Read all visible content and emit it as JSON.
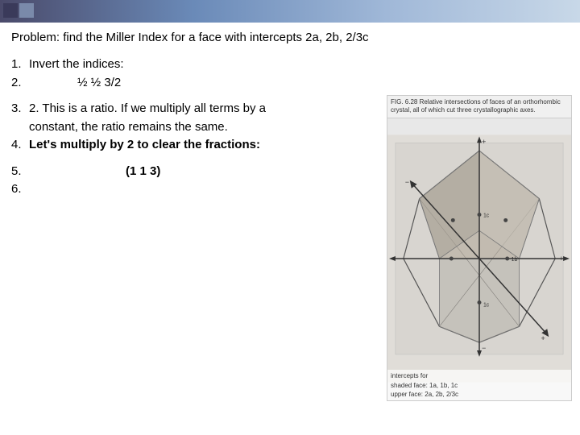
{
  "topbar": {
    "label": "top gradient bar"
  },
  "problem": {
    "title": "Problem: find the Miller Index for a face with intercepts 2a, 2b,  2/3c"
  },
  "steps": [
    {
      "num": "1.",
      "text": "Invert the indices:",
      "value": "",
      "bold": false
    },
    {
      "num": "2.",
      "text": "",
      "value": "½  ½  3/2",
      "bold": false
    },
    {
      "num": "3.",
      "text": "2. This is a ratio. If we multiply all terms by a",
      "continuation": "   constant, the ratio remains the same.",
      "value": "",
      "bold": false,
      "multiline": true
    },
    {
      "num": "4.",
      "text": "Let's multiply by 2 to clear the fractions:",
      "value": "",
      "bold": true
    },
    {
      "num": "5.",
      "text": "",
      "value": "(1 1 3)",
      "bold": true
    },
    {
      "num": "6.",
      "text": "",
      "value": "",
      "bold": false
    }
  ],
  "figure": {
    "caption": "FIG. 6.28  Relative intersections of faces of an orthorhombic crystal, all of which cut three crystallographic axes.",
    "intercept_note_line1": "intercepts for",
    "intercept_note_line2": "shaded face: 1a, 1b, 1c",
    "intercept_note_line3": "upper face: 2a, 2b, 2/3c"
  }
}
